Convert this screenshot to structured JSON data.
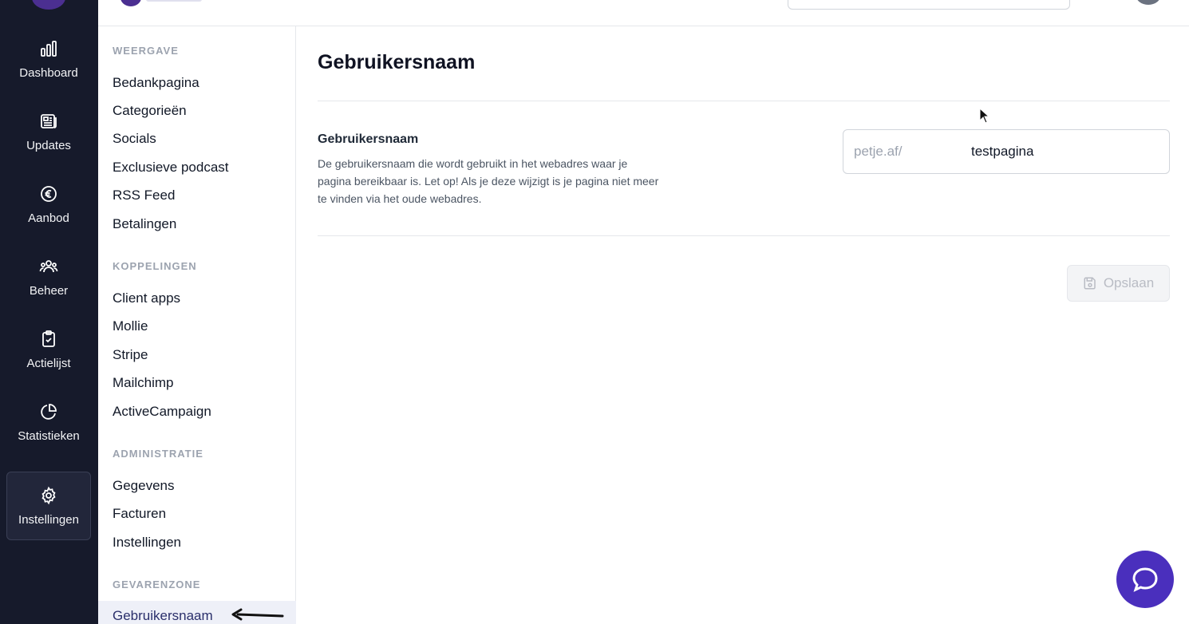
{
  "rail": {
    "items": [
      {
        "label": "Dashboard",
        "icon": "bar-chart-icon"
      },
      {
        "label": "Updates",
        "icon": "newspaper-icon"
      },
      {
        "label": "Aanbod",
        "icon": "euro-icon"
      },
      {
        "label": "Beheer",
        "icon": "users-icon"
      },
      {
        "label": "Actielijst",
        "icon": "clipboard-check-icon"
      },
      {
        "label": "Statistieken",
        "icon": "pie-chart-icon"
      },
      {
        "label": "Instellingen",
        "icon": "gear-icon"
      }
    ]
  },
  "nav": {
    "sections": [
      {
        "title": "WEERGAVE",
        "items": [
          "Bedankpagina",
          "Categorieën",
          "Socials",
          "Exclusieve podcast",
          "RSS Feed",
          "Betalingen"
        ]
      },
      {
        "title": "KOPPELINGEN",
        "items": [
          "Client apps",
          "Mollie",
          "Stripe",
          "Mailchimp",
          "ActiveCampaign"
        ]
      },
      {
        "title": "ADMINISTRATIE",
        "items": [
          "Gegevens",
          "Facturen",
          "Instellingen"
        ]
      },
      {
        "title": "GEVARENZONE",
        "items": [
          "Gebruikersnaam"
        ]
      }
    ]
  },
  "main": {
    "title": "Gebruikersnaam",
    "field_title": "Gebruikersnaam",
    "field_desc": "De gebruikersnaam die wordt gebruikt in het webadres waar je pagina bereikbaar is. Let op! Als je deze wijzigt is je pagina niet meer te vinden via het oude webadres.",
    "input_prefix": "petje.af/",
    "input_value": "testpagina",
    "save_label": "Opslaan"
  },
  "colors": {
    "rail_bg": "#161a2b",
    "accent": "#4a2fbd"
  }
}
